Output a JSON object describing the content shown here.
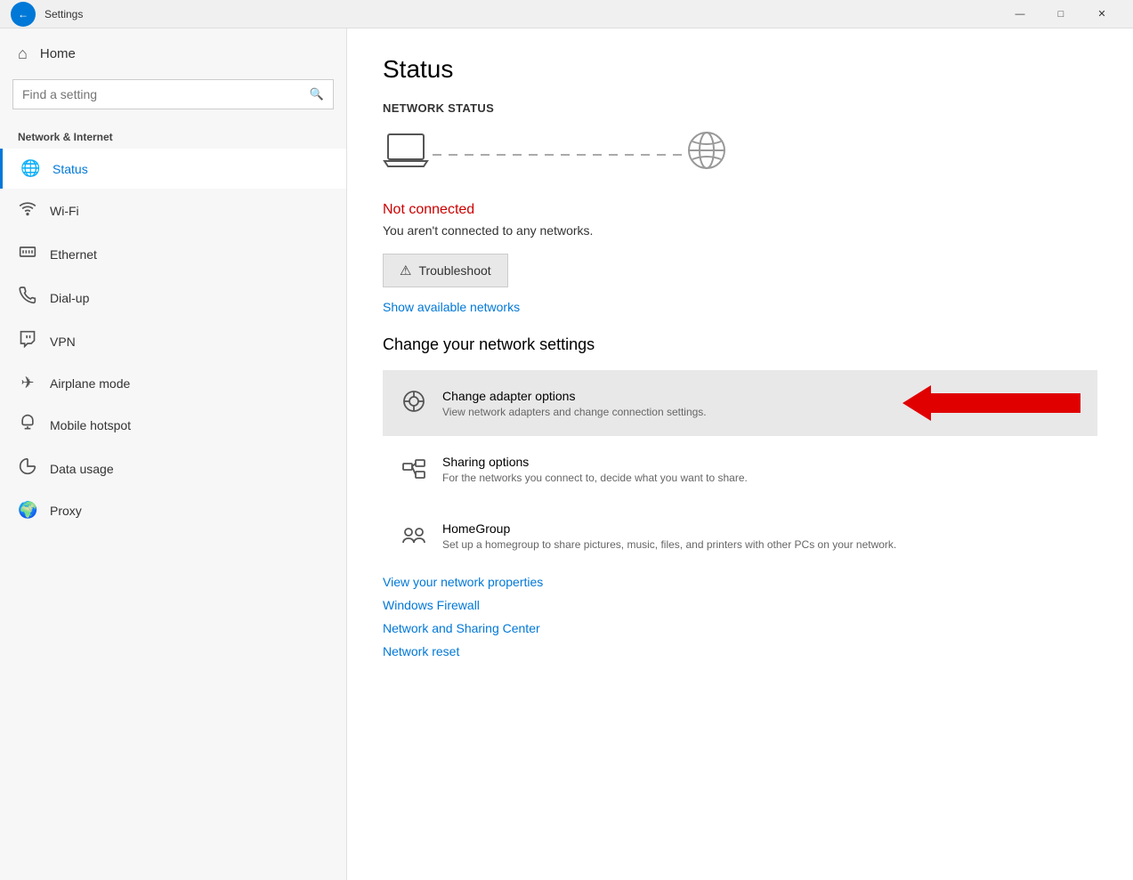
{
  "titlebar": {
    "title": "Settings",
    "back_label": "←",
    "minimize": "—",
    "maximize": "□",
    "close": "✕"
  },
  "sidebar": {
    "home_label": "Home",
    "search_placeholder": "Find a setting",
    "section_label": "Network & Internet",
    "items": [
      {
        "id": "status",
        "label": "Status",
        "icon": "🌐",
        "active": true
      },
      {
        "id": "wifi",
        "label": "Wi-Fi",
        "icon": "📶"
      },
      {
        "id": "ethernet",
        "label": "Ethernet",
        "icon": "🖥"
      },
      {
        "id": "dialup",
        "label": "Dial-up",
        "icon": "📞"
      },
      {
        "id": "vpn",
        "label": "VPN",
        "icon": "🔗"
      },
      {
        "id": "airplane",
        "label": "Airplane mode",
        "icon": "✈"
      },
      {
        "id": "hotspot",
        "label": "Mobile hotspot",
        "icon": "📡"
      },
      {
        "id": "datausage",
        "label": "Data usage",
        "icon": "📊"
      },
      {
        "id": "proxy",
        "label": "Proxy",
        "icon": "🌍"
      }
    ]
  },
  "content": {
    "page_title": "Status",
    "network_status_label": "Network status",
    "not_connected_text": "Not connected",
    "status_desc": "You aren't connected to any networks.",
    "troubleshoot_label": "Troubleshoot",
    "show_networks_label": "Show available networks",
    "change_settings_title": "Change your network settings",
    "settings": [
      {
        "id": "adapter",
        "title": "Change adapter options",
        "desc": "View network adapters and change connection settings.",
        "highlighted": true
      },
      {
        "id": "sharing",
        "title": "Sharing options",
        "desc": "For the networks you connect to, decide what you want to share."
      },
      {
        "id": "homegroup",
        "title": "HomeGroup",
        "desc": "Set up a homegroup to share pictures, music, files, and printers with other PCs on your network."
      }
    ],
    "bottom_links": [
      "View your network properties",
      "Windows Firewall",
      "Network and Sharing Center",
      "Network reset"
    ]
  }
}
